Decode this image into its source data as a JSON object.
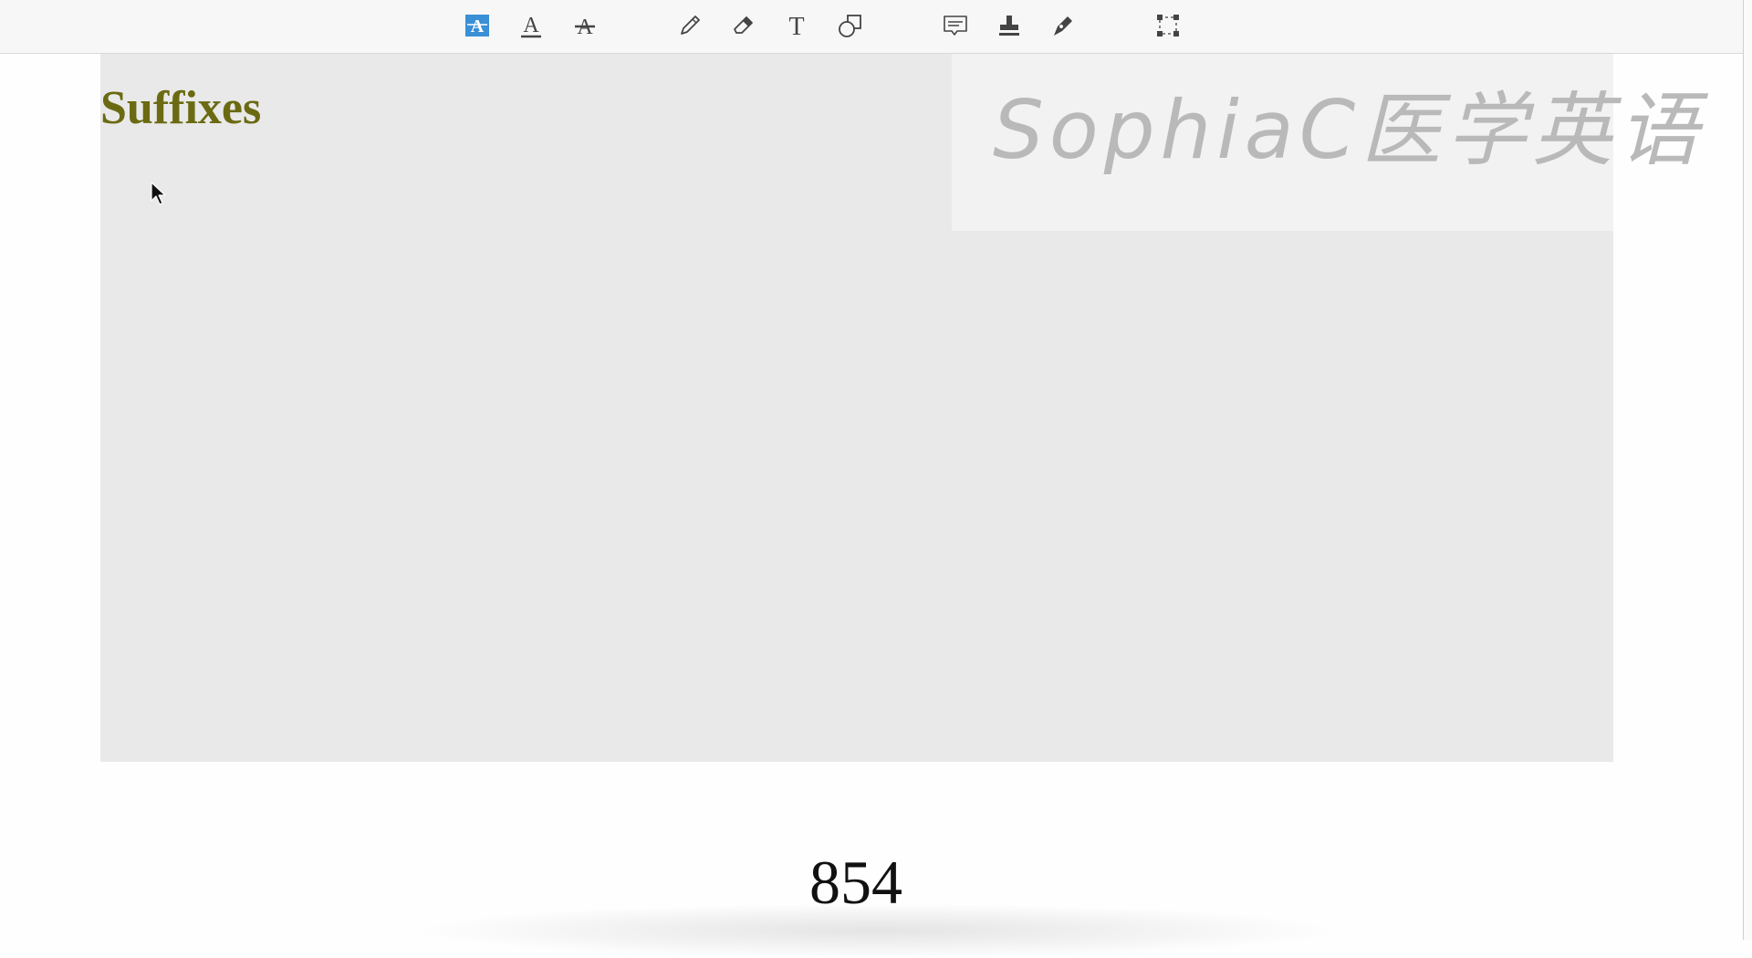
{
  "toolbar": {
    "accent": "#3a8fd6",
    "icon_color": "#444444",
    "tools": [
      {
        "name": "highlight-text-icon",
        "active": true
      },
      {
        "name": "underline-text-icon",
        "active": false
      },
      {
        "name": "strikethrough-text-icon",
        "active": false
      },
      {
        "name": "pencil-icon",
        "active": false
      },
      {
        "name": "eraser-icon",
        "active": false
      },
      {
        "name": "text-tool-icon",
        "active": false
      },
      {
        "name": "shapes-icon",
        "active": false
      },
      {
        "name": "comment-icon",
        "active": false
      },
      {
        "name": "stamp-icon",
        "active": false
      },
      {
        "name": "signature-pen-icon",
        "active": false
      },
      {
        "name": "selection-icon",
        "active": false
      }
    ]
  },
  "slide": {
    "title": "Suffixes",
    "title_color": "#6b6a12",
    "background": "#e9e9e9"
  },
  "watermark": {
    "text": "SophiaC医学英语"
  },
  "page": {
    "number": "854"
  }
}
